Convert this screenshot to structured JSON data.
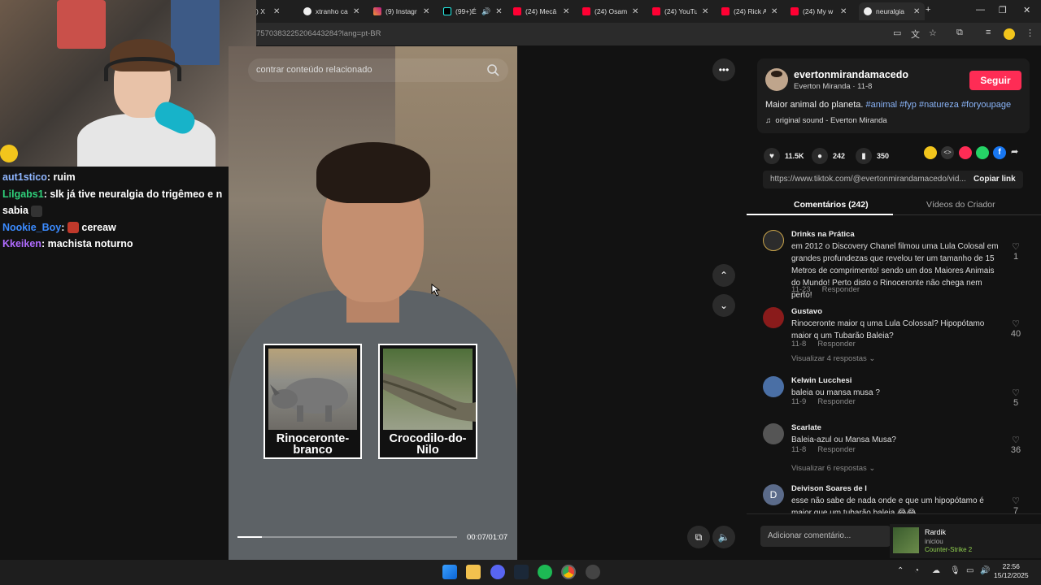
{
  "browser": {
    "tabs": [
      {
        "label": ") X"
      },
      {
        "label": "xtranho ca"
      },
      {
        "label": "(9) Instagr"
      },
      {
        "label": "(99+)É"
      },
      {
        "label": "(24) Mecâ"
      },
      {
        "label": "(24) Osam"
      },
      {
        "label": "(24) YouTu"
      },
      {
        "label": "(24) Rick A"
      },
      {
        "label": "(24) My w"
      },
      {
        "label": "neuralgia"
      }
    ],
    "url": "7570383225206443284?lang=pt-BR",
    "accent": "#fe2c55"
  },
  "stream_chat": [
    {
      "user": "aut1stico",
      "color": "#8fb6ff",
      "text": "ruim"
    },
    {
      "user": "Lilgabs1",
      "color": "#2fd07a",
      "text": "slk já tive neuralgia do trigêmeo e n sabia"
    },
    {
      "user": "Nookie_Boy",
      "color": "#3b8bff",
      "text": "cereaw"
    },
    {
      "user": "Kkeiken",
      "color": "#b06bff",
      "text": "machista noturno"
    }
  ],
  "video": {
    "search_placeholder": "contrar conteúdo relacionado",
    "card_left": "Rinoceronte-branco",
    "card_right": "Crocodilo-do-Nilo",
    "time": "00:07/01:07",
    "progress": 0.11
  },
  "author": {
    "username": "evertonmirandamacedo",
    "subline": "Everton Miranda · 11-8",
    "follow_label": "Seguir",
    "caption": "Maior animal do planeta.",
    "hashtags": "#animal #fyp #natureza #foryoupage",
    "sound": "original sound - Everton Miranda"
  },
  "stats": {
    "likes": "11.5K",
    "comments": "242",
    "saves": "350"
  },
  "link": {
    "url": "https://www.tiktok.com/@evertonmirandamacedo/vid...",
    "copy_label": "Copiar link"
  },
  "tabs": {
    "comments": "Comentários (242)",
    "creator": "Vídeos do Criador"
  },
  "comments": [
    {
      "name": "Drinks na Prática",
      "text": "em 2012 o Discovery Chanel filmou uma Lula Colosal em grandes profundezas que revelou ter um tamanho de 15 Metros de comprimento! sendo um dos Maiores Animais do Mundo! Perto disto o Rinoceronte não chega nem perto!",
      "date": "11-23",
      "reply": "Responder",
      "likes": "1"
    },
    {
      "name": "Gustavo",
      "text": "Rinoceronte maior q uma Lula Colossal? Hipopótamo maior q um Tubarão Baleia?",
      "date": "11-8",
      "reply": "Responder",
      "likes": "40",
      "more": "Visualizar 4 respostas"
    },
    {
      "name": "Kelwin Lucchesi",
      "text": "baleia ou mansa musa ?",
      "date": "11-9",
      "reply": "Responder",
      "likes": "5"
    },
    {
      "name": "Scarlate",
      "text": "Baleia-azul ou Mansa Musa?",
      "date": "11-8",
      "reply": "Responder",
      "likes": "36",
      "more": "Visualizar 6 respostas"
    },
    {
      "name": "Deivison Soares de l",
      "initial": "D",
      "text": "esse não sabe de nada onde e que um hipopótamo é maior que um tubarão baleia 😂😂",
      "likes": "7"
    }
  ],
  "comment_input_placeholder": "Adicionar comentário...",
  "notification": {
    "name": "Rardik",
    "status": "iniciou",
    "game": "Counter-Strike 2"
  },
  "clock": {
    "time": "22:56",
    "date": "15/12/2025"
  }
}
